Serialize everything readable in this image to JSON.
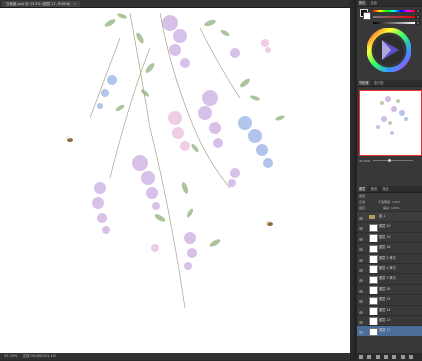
{
  "document": {
    "tab_title": "白紫藤.psd @ 33.3% (图层 17, RGB/8)",
    "close_glyph": "×"
  },
  "status": {
    "zoom": "33.33%",
    "doc_size": "文档:39.8M/251.1M"
  },
  "panels": {
    "color_tabs": [
      "颜色",
      "色板"
    ],
    "nav_tabs": [
      "导航器",
      "直方图"
    ],
    "nav_zoom": "33.33%",
    "layer_tabs": [
      "图层",
      "通道",
      "路径"
    ],
    "layer_filter": "类型",
    "blend_mode": "正常",
    "opacity_label": "不透明度:",
    "opacity": "100%",
    "lock_label": "锁定:",
    "fill_label": "填充:",
    "fill": "100%",
    "color_values": [
      "0",
      "0",
      "0"
    ]
  },
  "layers": [
    {
      "name": "组 1",
      "type": "group"
    },
    {
      "name": "图层 20",
      "type": "layer"
    },
    {
      "name": "图层 19",
      "type": "layer"
    },
    {
      "name": "图层 18",
      "type": "layer"
    },
    {
      "name": "图层 5 拷贝",
      "type": "layer"
    },
    {
      "name": "图层 4 拷贝",
      "type": "layer"
    },
    {
      "name": "图层 3 拷贝",
      "type": "layer"
    },
    {
      "name": "图层 16",
      "type": "layer"
    },
    {
      "name": "图层 15",
      "type": "layer"
    },
    {
      "name": "图层 14",
      "type": "layer"
    },
    {
      "name": "图层 13",
      "type": "layer"
    },
    {
      "name": "图层 17",
      "type": "layer",
      "selected": true
    }
  ],
  "colors": {
    "accent_selection": "#4a6d9a",
    "nav_frame": "#e33333",
    "wisteria_purple": "#b98fd6",
    "wisteria_blue": "#7f9ee0",
    "wisteria_pink": "#e3a6cf",
    "leaf_green": "#8fb17a"
  }
}
